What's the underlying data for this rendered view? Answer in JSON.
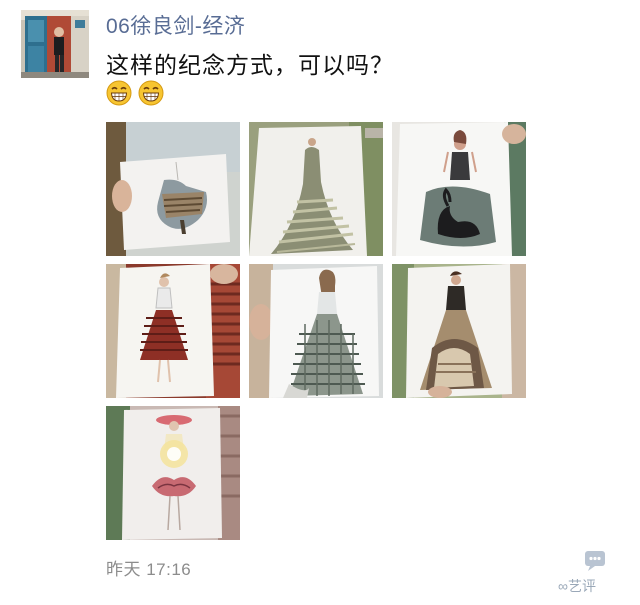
{
  "post": {
    "username": "06徐良剑-经济",
    "message": "这样的纪念方式，可以吗？",
    "emojis": [
      "grinning-face-icon",
      "grinning-face-icon"
    ],
    "timestamp": "昨天 17:16"
  },
  "photos": [
    {
      "name": "photo-1",
      "subject": "paper-dress-silhouette-shipwreck"
    },
    {
      "name": "photo-2",
      "subject": "paper-gown-silhouette-stadium-seats"
    },
    {
      "name": "photo-3",
      "subject": "paper-dress-silhouette-black-swan"
    },
    {
      "name": "photo-4",
      "subject": "paper-dress-silhouette-red-shutter"
    },
    {
      "name": "photo-5",
      "subject": "paper-gown-silhouette-building"
    },
    {
      "name": "photo-6",
      "subject": "paper-dress-silhouette-archway"
    },
    {
      "name": "photo-7",
      "subject": "paper-dress-silhouette-flower"
    }
  ],
  "watermark": {
    "text": "艺评",
    "icon": "chat-bubble-icon"
  },
  "colors": {
    "username": "#586c94",
    "message": "#111111",
    "timestamp": "#8c8c8c"
  }
}
